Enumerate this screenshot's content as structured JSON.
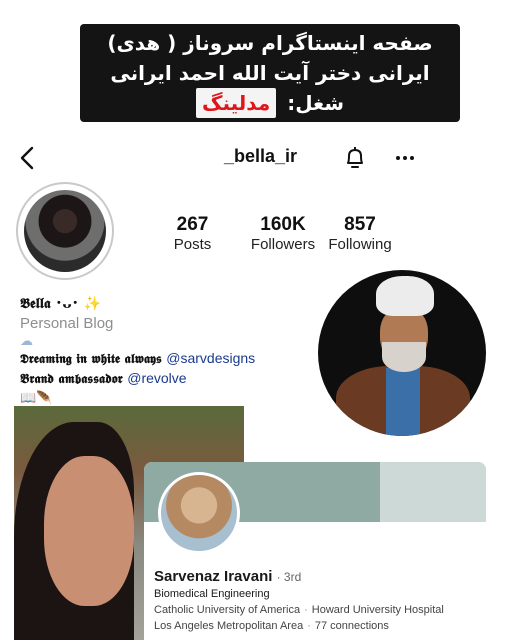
{
  "caption": {
    "line1": "صفحه اینستاگرام سروناز ( هدی)",
    "line2": "ایرانی دختر آیت الله احمد ایرانی",
    "job_label": "شغل:",
    "job_value": "مدلینگ"
  },
  "instagram": {
    "username": "_bella_ir",
    "stats": [
      {
        "value": "267",
        "label": "Posts"
      },
      {
        "value": "160K",
        "label": "Followers"
      },
      {
        "value": "857",
        "label": "Following"
      }
    ],
    "bio": {
      "name": "𝕭𝖊𝖑𝖑𝖆 ･ᴗ･ ✨",
      "category": "Personal Blog",
      "cloud": "☁",
      "line1_text": "𝕯𝖗𝖊𝖆𝖒𝖎𝖓𝖌 𝖎𝖓 𝖜𝖍𝖎𝖙𝖊 𝖆𝖑𝖜𝖆𝖞𝖘",
      "line1_tag": "@sarvdesigns",
      "line2_text": "𝕭𝖗𝖆𝖓𝖉 𝖆𝖒𝖇𝖆𝖘𝖘𝖆𝖉𝖔𝖗",
      "line2_tag": "@revolve",
      "emojis": "📖🪶"
    }
  },
  "linkedin": {
    "name": "Sarvenaz Iravani",
    "degree": "· 3rd",
    "headline": "Biomedical Engineering",
    "education": "Catholic University of America",
    "employer": "Howard University Hospital",
    "location": "Los Angeles Metropolitan Area",
    "connections": "77 connections"
  }
}
